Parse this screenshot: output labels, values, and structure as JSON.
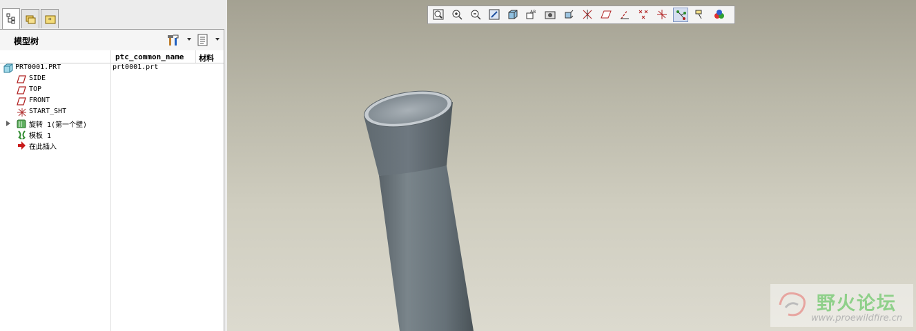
{
  "tabs": [
    {
      "name": "model-tree-tab",
      "icon": "model-tree-icon",
      "active": true
    },
    {
      "name": "folder-browser-tab",
      "icon": "folder-icon",
      "active": false
    },
    {
      "name": "favorites-tab",
      "icon": "favorites-icon",
      "active": false
    }
  ],
  "panel": {
    "title": "模型树",
    "settings_icon": "tree-settings-icon",
    "show_icon": "tree-show-icon"
  },
  "columns": {
    "name_header": "",
    "common_name": "ptc_common_name",
    "material": "材料"
  },
  "tree": [
    {
      "label": "PRT0001.PRT",
      "icon": "part-icon",
      "value": "prt0001.prt"
    },
    {
      "label": "SIDE",
      "icon": "datum-plane-icon"
    },
    {
      "label": "TOP",
      "icon": "datum-plane-icon"
    },
    {
      "label": "FRONT",
      "icon": "datum-plane-icon"
    },
    {
      "label": "START_SHT",
      "icon": "coordinate-system-icon"
    },
    {
      "label": "旋转 1(第一个壁)",
      "icon": "revolve-icon",
      "expandable": true
    },
    {
      "label": "模板 1",
      "icon": "template-icon"
    },
    {
      "label": "在此插入",
      "icon": "insert-here-arrow-icon"
    }
  ],
  "toolbar": [
    {
      "name": "refit-button",
      "icon": "refit-icon"
    },
    {
      "name": "zoom-in-button",
      "icon": "zoom-in-icon"
    },
    {
      "name": "zoom-out-button",
      "icon": "zoom-out-icon"
    },
    {
      "name": "repaint-button",
      "icon": "repaint-icon"
    },
    {
      "name": "display-style-button",
      "icon": "display-style-icon"
    },
    {
      "name": "saved-views-button",
      "icon": "saved-views-icon"
    },
    {
      "name": "view-manager-button",
      "icon": "view-manager-icon"
    },
    {
      "name": "perspective-button",
      "icon": "perspective-icon"
    },
    {
      "name": "datum-display-button",
      "icon": "datum-display-icon"
    },
    {
      "name": "plane-display-button",
      "icon": "plane-display-icon"
    },
    {
      "name": "axis-display-button",
      "icon": "axis-display-icon"
    },
    {
      "name": "point-display-button",
      "icon": "point-display-icon"
    },
    {
      "name": "csys-display-button",
      "icon": "csys-display-icon"
    },
    {
      "name": "spin-center-button",
      "icon": "spin-center-icon",
      "pressed": true
    },
    {
      "name": "annotation-display-button",
      "icon": "annotation-display-icon"
    },
    {
      "name": "appearance-button",
      "icon": "appearance-icon"
    }
  ],
  "watermark": {
    "title": "野火论坛",
    "url": "www.proewildfire.cn"
  },
  "colors": {
    "panel_bg": "#ffffff",
    "viewport_top": "#a4a192",
    "viewport_bottom": "#dcdacf",
    "model_gray": "#6e7880",
    "toolbar_bg": "#f4f4f4"
  }
}
